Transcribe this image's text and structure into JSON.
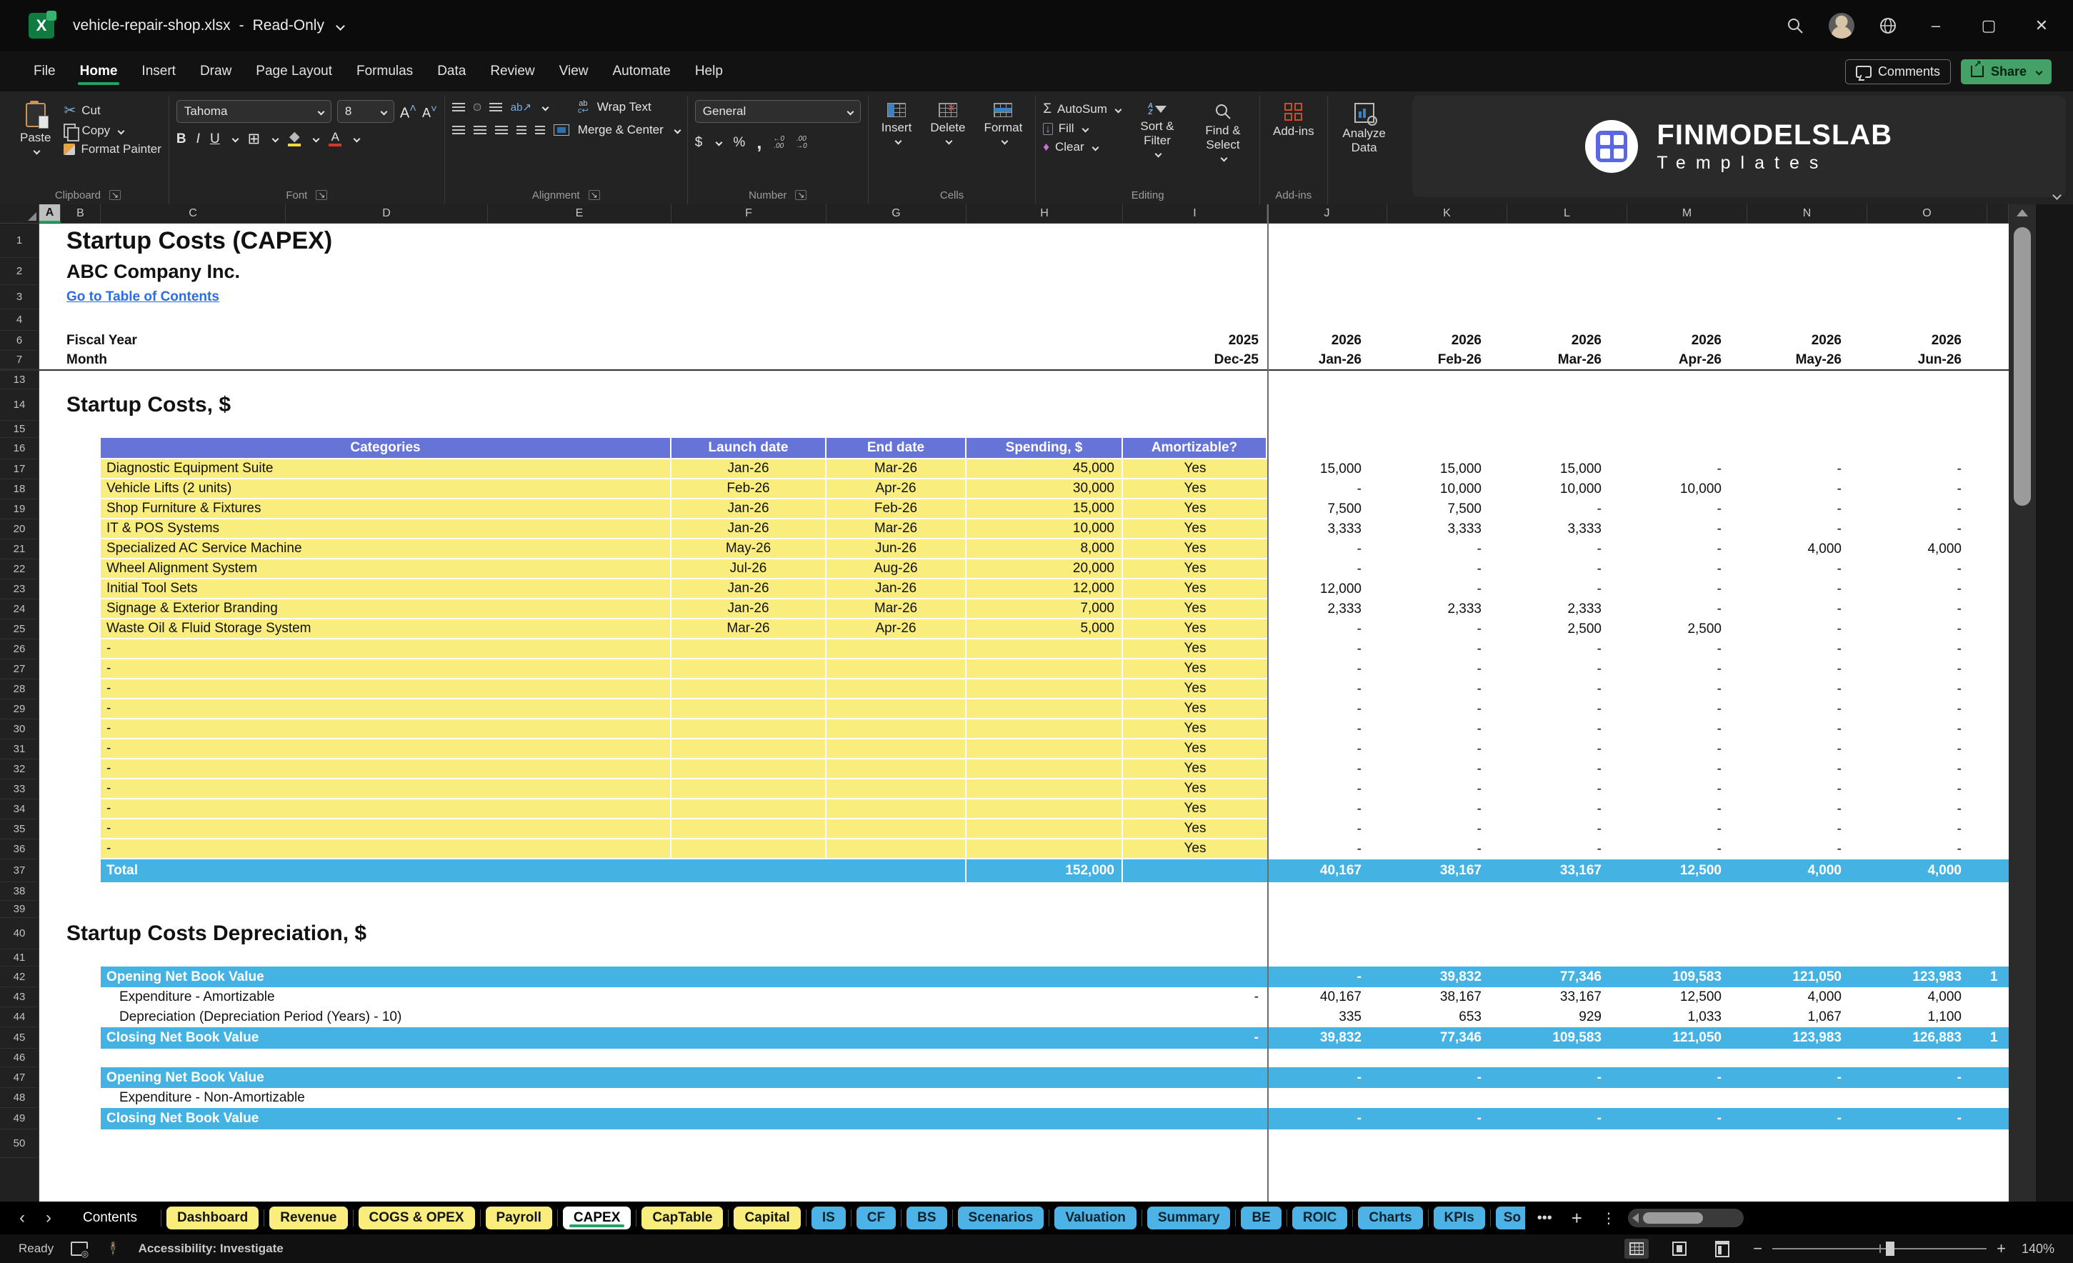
{
  "titlebar": {
    "file_name": "vehicle-repair-shop.xlsx",
    "separator": "-",
    "mode": "Read-Only"
  },
  "menubar": {
    "items": [
      "File",
      "Home",
      "Insert",
      "Draw",
      "Page Layout",
      "Formulas",
      "Data",
      "Review",
      "View",
      "Automate",
      "Help"
    ],
    "active": "Home",
    "comments": "Comments",
    "share": "Share"
  },
  "ribbon": {
    "paste": "Paste",
    "cut": "Cut",
    "copy": "Copy",
    "format_painter": "Format Painter",
    "group_clipboard": "Clipboard",
    "font_name": "Tahoma",
    "font_size": "8",
    "group_font": "Font",
    "wrap_text": "Wrap Text",
    "merge_center": "Merge & Center",
    "group_alignment": "Alignment",
    "number_format": "General",
    "group_number": "Number",
    "insert": "Insert",
    "delete": "Delete",
    "format": "Format",
    "group_cells": "Cells",
    "autosum": "AutoSum",
    "fill": "Fill",
    "clear": "Clear",
    "sort_filter": "Sort & Filter",
    "find_select": "Find & Select",
    "group_editing": "Editing",
    "addins": "Add-ins",
    "group_addins": "Add-ins",
    "analyze": "Analyze Data"
  },
  "brand": {
    "name": "FINMODELSLAB",
    "sub": "Templates"
  },
  "sheet": {
    "columns": [
      "A",
      "B",
      "C",
      "D",
      "E",
      "F",
      "G",
      "H",
      "I",
      "J",
      "K",
      "L",
      "M",
      "N",
      "O"
    ],
    "selected_column": "A",
    "table_headers": {
      "categories": "Categories",
      "launch": "Launch date",
      "end": "End date",
      "spending": "Spending, $",
      "amortizable": "Amortizable?"
    },
    "rows": [
      {
        "n": "1",
        "type": "title",
        "text": "Startup Costs (CAPEX)",
        "h": 48
      },
      {
        "n": "2",
        "type": "subtitle",
        "text": "ABC Company Inc.",
        "h": 38
      },
      {
        "n": "3",
        "type": "link",
        "text": "Go to Table of Contents",
        "h": 34
      },
      {
        "n": "4",
        "type": "blank",
        "h": 30
      },
      {
        "n": "6",
        "type": "fiscal",
        "label": "Fiscal Year",
        "col_i": "2025",
        "months": [
          "2026",
          "2026",
          "2026",
          "2026",
          "2026",
          "2026"
        ],
        "h": 28
      },
      {
        "n": "7",
        "type": "fiscal",
        "label": "Month",
        "col_i": "Dec-25",
        "months": [
          "Jan-26",
          "Feb-26",
          "Mar-26",
          "Apr-26",
          "May-26",
          "Jun-26"
        ],
        "h": 28,
        "rule": true
      },
      {
        "n": "13",
        "type": "blank",
        "h": 26
      },
      {
        "n": "14",
        "type": "section",
        "text": "Startup Costs, $",
        "h": 44
      },
      {
        "n": "15",
        "type": "blank",
        "h": 24
      },
      {
        "n": "16",
        "type": "thead",
        "h": 30
      },
      {
        "n": "17",
        "type": "item",
        "name": "Diagnostic Equipment Suite",
        "launch": "Jan-26",
        "end": "Mar-26",
        "spend": "45,000",
        "amort": "Yes",
        "months": [
          "15,000",
          "15,000",
          "15,000",
          "-",
          "-",
          "-"
        ],
        "h": 28
      },
      {
        "n": "18",
        "type": "item",
        "name": "Vehicle Lifts (2 units)",
        "launch": "Feb-26",
        "end": "Apr-26",
        "spend": "30,000",
        "amort": "Yes",
        "months": [
          "-",
          "10,000",
          "10,000",
          "10,000",
          "-",
          "-"
        ],
        "h": 28
      },
      {
        "n": "19",
        "type": "item",
        "name": "Shop Furniture & Fixtures",
        "launch": "Jan-26",
        "end": "Feb-26",
        "spend": "15,000",
        "amort": "Yes",
        "months": [
          "7,500",
          "7,500",
          "-",
          "-",
          "-",
          "-"
        ],
        "h": 28
      },
      {
        "n": "20",
        "type": "item",
        "name": "IT & POS Systems",
        "launch": "Jan-26",
        "end": "Mar-26",
        "spend": "10,000",
        "amort": "Yes",
        "months": [
          "3,333",
          "3,333",
          "3,333",
          "-",
          "-",
          "-"
        ],
        "h": 28
      },
      {
        "n": "21",
        "type": "item",
        "name": "Specialized AC Service Machine",
        "launch": "May-26",
        "end": "Jun-26",
        "spend": "8,000",
        "amort": "Yes",
        "months": [
          "-",
          "-",
          "-",
          "-",
          "4,000",
          "4,000"
        ],
        "h": 28
      },
      {
        "n": "22",
        "type": "item",
        "name": "Wheel Alignment System",
        "launch": "Jul-26",
        "end": "Aug-26",
        "spend": "20,000",
        "amort": "Yes",
        "months": [
          "-",
          "-",
          "-",
          "-",
          "-",
          "-"
        ],
        "h": 28
      },
      {
        "n": "23",
        "type": "item",
        "name": "Initial Tool Sets",
        "launch": "Jan-26",
        "end": "Jan-26",
        "spend": "12,000",
        "amort": "Yes",
        "months": [
          "12,000",
          "-",
          "-",
          "-",
          "-",
          "-"
        ],
        "h": 28
      },
      {
        "n": "24",
        "type": "item",
        "name": "Signage & Exterior Branding",
        "launch": "Jan-26",
        "end": "Mar-26",
        "spend": "7,000",
        "amort": "Yes",
        "months": [
          "2,333",
          "2,333",
          "2,333",
          "-",
          "-",
          "-"
        ],
        "h": 28
      },
      {
        "n": "25",
        "type": "item",
        "name": "Waste Oil & Fluid Storage System",
        "launch": "Mar-26",
        "end": "Apr-26",
        "spend": "5,000",
        "amort": "Yes",
        "months": [
          "-",
          "-",
          "2,500",
          "2,500",
          "-",
          "-"
        ],
        "h": 28
      },
      {
        "n": "26",
        "type": "item",
        "name": "-",
        "launch": "",
        "end": "",
        "spend": "",
        "amort": "Yes",
        "months": [
          "-",
          "-",
          "-",
          "-",
          "-",
          "-"
        ],
        "h": 28
      },
      {
        "n": "27",
        "type": "item",
        "name": "-",
        "launch": "",
        "end": "",
        "spend": "",
        "amort": "Yes",
        "months": [
          "-",
          "-",
          "-",
          "-",
          "-",
          "-"
        ],
        "h": 28
      },
      {
        "n": "28",
        "type": "item",
        "name": "-",
        "launch": "",
        "end": "",
        "spend": "",
        "amort": "Yes",
        "months": [
          "-",
          "-",
          "-",
          "-",
          "-",
          "-"
        ],
        "h": 28
      },
      {
        "n": "29",
        "type": "item",
        "name": "-",
        "launch": "",
        "end": "",
        "spend": "",
        "amort": "Yes",
        "months": [
          "-",
          "-",
          "-",
          "-",
          "-",
          "-"
        ],
        "h": 28
      },
      {
        "n": "30",
        "type": "item",
        "name": "-",
        "launch": "",
        "end": "",
        "spend": "",
        "amort": "Yes",
        "months": [
          "-",
          "-",
          "-",
          "-",
          "-",
          "-"
        ],
        "h": 28
      },
      {
        "n": "31",
        "type": "item",
        "name": "-",
        "launch": "",
        "end": "",
        "spend": "",
        "amort": "Yes",
        "months": [
          "-",
          "-",
          "-",
          "-",
          "-",
          "-"
        ],
        "h": 28
      },
      {
        "n": "32",
        "type": "item",
        "name": "-",
        "launch": "",
        "end": "",
        "spend": "",
        "amort": "Yes",
        "months": [
          "-",
          "-",
          "-",
          "-",
          "-",
          "-"
        ],
        "h": 28
      },
      {
        "n": "33",
        "type": "item",
        "name": "-",
        "launch": "",
        "end": "",
        "spend": "",
        "amort": "Yes",
        "months": [
          "-",
          "-",
          "-",
          "-",
          "-",
          "-"
        ],
        "h": 28
      },
      {
        "n": "34",
        "type": "item",
        "name": "-",
        "launch": "",
        "end": "",
        "spend": "",
        "amort": "Yes",
        "months": [
          "-",
          "-",
          "-",
          "-",
          "-",
          "-"
        ],
        "h": 28
      },
      {
        "n": "35",
        "type": "item",
        "name": "-",
        "launch": "",
        "end": "",
        "spend": "",
        "amort": "Yes",
        "months": [
          "-",
          "-",
          "-",
          "-",
          "-",
          "-"
        ],
        "h": 28
      },
      {
        "n": "36",
        "type": "item",
        "name": "-",
        "launch": "",
        "end": "",
        "spend": "",
        "amort": "Yes",
        "months": [
          "-",
          "-",
          "-",
          "-",
          "-",
          "-"
        ],
        "h": 28
      },
      {
        "n": "37",
        "type": "total",
        "label": "Total",
        "spend": "152,000",
        "months": [
          "40,167",
          "38,167",
          "33,167",
          "12,500",
          "4,000",
          "4,000"
        ],
        "h": 32
      },
      {
        "n": "38",
        "type": "blank",
        "h": 26
      },
      {
        "n": "39",
        "type": "blank",
        "h": 24
      },
      {
        "n": "40",
        "type": "section",
        "text": "Startup Costs Depreciation, $",
        "h": 44
      },
      {
        "n": "41",
        "type": "blank",
        "h": 24
      },
      {
        "n": "42",
        "type": "band",
        "label": "Opening Net Book Value",
        "col_i": "",
        "months": [
          "-",
          "39,832",
          "77,346",
          "109,583",
          "121,050",
          "123,983"
        ],
        "partial": "1",
        "h": 29
      },
      {
        "n": "43",
        "type": "plain",
        "label": "Expenditure - Amortizable",
        "col_i": "-",
        "months": [
          "40,167",
          "38,167",
          "33,167",
          "12,500",
          "4,000",
          "4,000"
        ],
        "h": 28
      },
      {
        "n": "44",
        "type": "plain",
        "label": "Depreciation (Depreciation Period (Years) - 10)",
        "col_i": "",
        "months": [
          "335",
          "653",
          "929",
          "1,033",
          "1,067",
          "1,100"
        ],
        "h": 28
      },
      {
        "n": "45",
        "type": "band",
        "label": "Closing Net Book Value",
        "col_i": "-",
        "months": [
          "39,832",
          "77,346",
          "109,583",
          "121,050",
          "123,983",
          "126,883"
        ],
        "partial": "1",
        "h": 30
      },
      {
        "n": "46",
        "type": "blank",
        "h": 26
      },
      {
        "n": "47",
        "type": "band",
        "label": "Opening Net Book Value",
        "col_i": "",
        "months": [
          "-",
          "-",
          "-",
          "-",
          "-",
          "-"
        ],
        "h": 29
      },
      {
        "n": "48",
        "type": "plain",
        "label": "Expenditure - Non-Amortizable",
        "col_i": "",
        "months": [
          "",
          "",
          "",
          "",
          "",
          ""
        ],
        "h": 28
      },
      {
        "n": "49",
        "type": "band",
        "label": "Closing Net Book Value",
        "col_i": "",
        "months": [
          "-",
          "-",
          "-",
          "-",
          "-",
          "-"
        ],
        "h": 30
      },
      {
        "n": "50",
        "type": "blank",
        "h": 40
      }
    ]
  },
  "tabs": {
    "items": [
      {
        "label": "Contents",
        "style": "plain"
      },
      {
        "label": "Dashboard",
        "style": "yellow"
      },
      {
        "label": "Revenue",
        "style": "yellow"
      },
      {
        "label": "COGS & OPEX",
        "style": "yellow"
      },
      {
        "label": "Payroll",
        "style": "yellow"
      },
      {
        "label": "CAPEX",
        "style": "active"
      },
      {
        "label": "CapTable",
        "style": "yellow"
      },
      {
        "label": "Capital",
        "style": "yellow"
      },
      {
        "label": "IS",
        "style": "blue"
      },
      {
        "label": "CF",
        "style": "blue"
      },
      {
        "label": "BS",
        "style": "blue"
      },
      {
        "label": "Scenarios",
        "style": "blue"
      },
      {
        "label": "Valuation",
        "style": "blue"
      },
      {
        "label": "Summary",
        "style": "blue"
      },
      {
        "label": "BE",
        "style": "blue"
      },
      {
        "label": "ROIC",
        "style": "blue"
      },
      {
        "label": "Charts",
        "style": "blue"
      },
      {
        "label": "KPIs",
        "style": "blue"
      },
      {
        "label": "So",
        "style": "blue-clip"
      }
    ],
    "more": "•••",
    "add": "+",
    "menu": "⋮"
  },
  "statusbar": {
    "ready": "Ready",
    "accessibility": "Accessibility: Investigate",
    "zoom": "140%"
  },
  "colors": {
    "accent_green": "#21a366",
    "header_blue": "#6674d8",
    "row_yellow": "#f9ed7d",
    "band_blue": "#45b2e4",
    "link_blue": "#2b6de4",
    "tab_blue": "#4db3e6"
  }
}
